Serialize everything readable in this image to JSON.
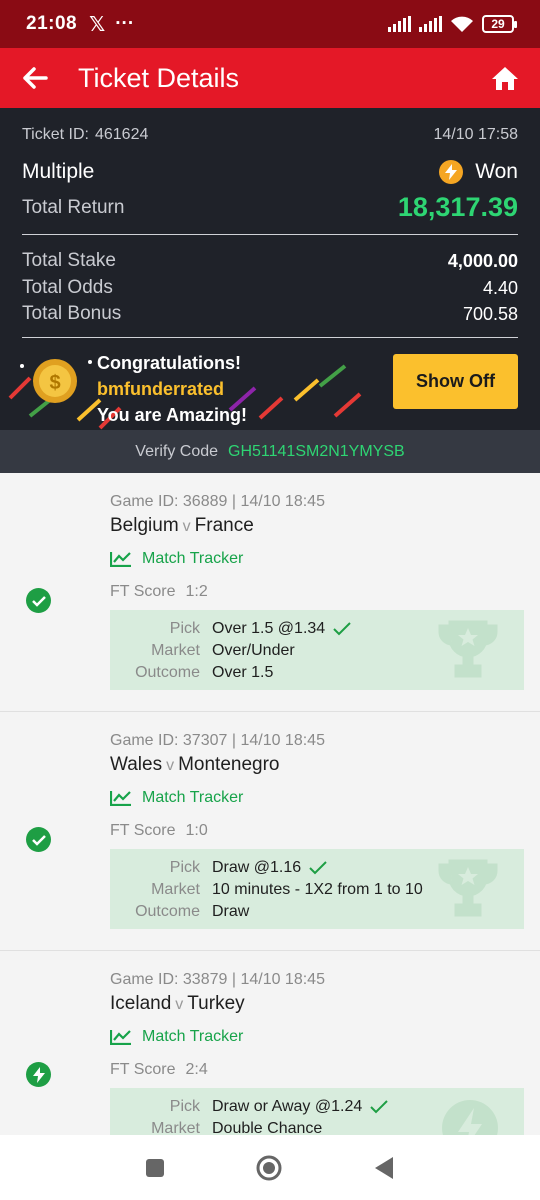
{
  "status_bar": {
    "time": "21:08",
    "x_glyph": "𝕏",
    "dots": "···",
    "battery": "29"
  },
  "header": {
    "title": "Ticket Details"
  },
  "ticket": {
    "id_label": "Ticket ID:",
    "id": "461624",
    "datetime": "14/10 17:58",
    "type": "Multiple",
    "status": "Won",
    "total_return_label": "Total Return",
    "total_return": "18,317.39",
    "stake_label": "Total Stake",
    "stake": "4,000.00",
    "odds_label": "Total Odds",
    "odds": "4.40",
    "bonus_label": "Total Bonus",
    "bonus": "700.58"
  },
  "banner": {
    "line1": "Congratulations!",
    "username": "bmfunderrated",
    "line3": "You are Amazing!",
    "button": "Show Off"
  },
  "verify": {
    "label": "Verify Code",
    "code": "GH51141SM2N1YMYSB"
  },
  "labels": {
    "tracker": "Match Tracker",
    "ft_score": "FT Score",
    "pick": "Pick",
    "market": "Market",
    "outcome": "Outcome",
    "v": "v"
  },
  "games": [
    {
      "header": "Game ID: 36889 | 14/10 18:45",
      "home": "Belgium",
      "away": "France",
      "score": "1:2",
      "pick": "Over 1.5 @1.34",
      "market": "Over/Under",
      "outcome": "Over 1.5",
      "status_icon": "check-circle-icon"
    },
    {
      "header": "Game ID: 37307 | 14/10 18:45",
      "home": "Wales",
      "away": "Montenegro",
      "score": "1:0",
      "pick": "Draw @1.16",
      "market": "10 minutes - 1X2 from 1 to 10",
      "outcome": "Draw",
      "status_icon": "check-circle-icon"
    },
    {
      "header": "Game ID: 33879 | 14/10 18:45",
      "home": "Iceland",
      "away": "Turkey",
      "score": "2:4",
      "pick": "Draw or Away @1.24",
      "market": "Double Chance",
      "outcome": "",
      "status_icon": "bolt-circle-icon"
    }
  ],
  "colors": {
    "brand_red": "#e41827",
    "dark": "#1f2229",
    "win_green": "#2ed573",
    "accent_yellow": "#fbc02d"
  }
}
